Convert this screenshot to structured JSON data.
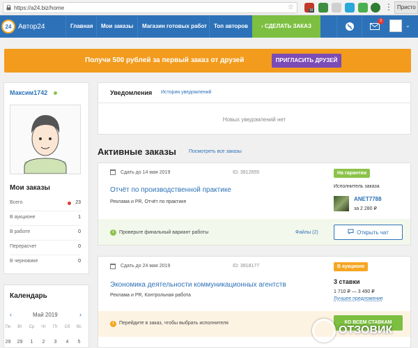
{
  "browser": {
    "url": "https://a24.biz/home",
    "ext_badge": "16",
    "right_button": "Присто"
  },
  "nav": {
    "logo_badge": "24",
    "logo_text": "Автор24",
    "links": [
      "Главная",
      "Мои заказы",
      "Магазин готовых работ",
      "Топ авторов"
    ],
    "cta": "› СДЕЛАТЬ ЗАКАЗ",
    "mail_badge": "3"
  },
  "promo": {
    "text": "Получи 500 рублей за первый заказ от друзей",
    "button": "ПРИГЛАСИТЬ ДРУЗЕЙ",
    "color": "#f29b1d",
    "button_color": "#7b4bb6"
  },
  "profile": {
    "username": "Максим1742",
    "orders_title": "Мои заказы",
    "stats": [
      {
        "label": "Всего",
        "value": "23"
      },
      {
        "label": "В аукционе",
        "value": "1"
      },
      {
        "label": "В работе",
        "value": "0"
      },
      {
        "label": "Перерасчет",
        "value": "0"
      },
      {
        "label": "В черновике",
        "value": "0"
      }
    ]
  },
  "calendar": {
    "title": "Календарь",
    "month": "Май 2019",
    "weekdays": [
      "Пн",
      "Вт",
      "Ср",
      "Чт",
      "Пт",
      "Сб",
      "Вс"
    ],
    "days": [
      "29",
      "29",
      "1",
      "2",
      "3",
      "4",
      "5"
    ]
  },
  "notifications": {
    "tab": "Уведомления",
    "history": "История уведомлений",
    "empty": "Новых уведомлений нет"
  },
  "active_orders": {
    "title": "Активные заказы",
    "view_all": "Посмотреть все заказы",
    "orders": [
      {
        "date": "Сдать до 14 мая 2019",
        "id": "ID: 3912655",
        "title": "Отчёт по производственной практике",
        "category": "Реклама и PR, Отчёт по практике",
        "status": "На гарантии",
        "status_color": "#8bc34a",
        "executor_label": "Исполнитель заказа",
        "executor_name": "ANET7788",
        "executor_price": "за 2 280 ₽",
        "notice": "Проверьте финальный вариант работы",
        "files": "Файлы (2)",
        "button": "Открыть чат"
      },
      {
        "date": "Сдать до 24 мая 2019",
        "id": "ID: 3918177",
        "title": "Экономика деятельности коммуникационных агентств",
        "category": "Реклама и PR, Контрольная работа",
        "status": "В аукционе",
        "status_color": "#f5a623",
        "bids": "3 ставки",
        "range": "1 710 ₽ — 3 490 ₽",
        "best": "Лучшее предложение",
        "notice": "Перейдите в заказ, чтобы выбрать исполнителя",
        "button": "КО ВСЕМ СТАВКАМ"
      }
    ]
  },
  "watermark": {
    "text": "ОТЗОВИК"
  }
}
